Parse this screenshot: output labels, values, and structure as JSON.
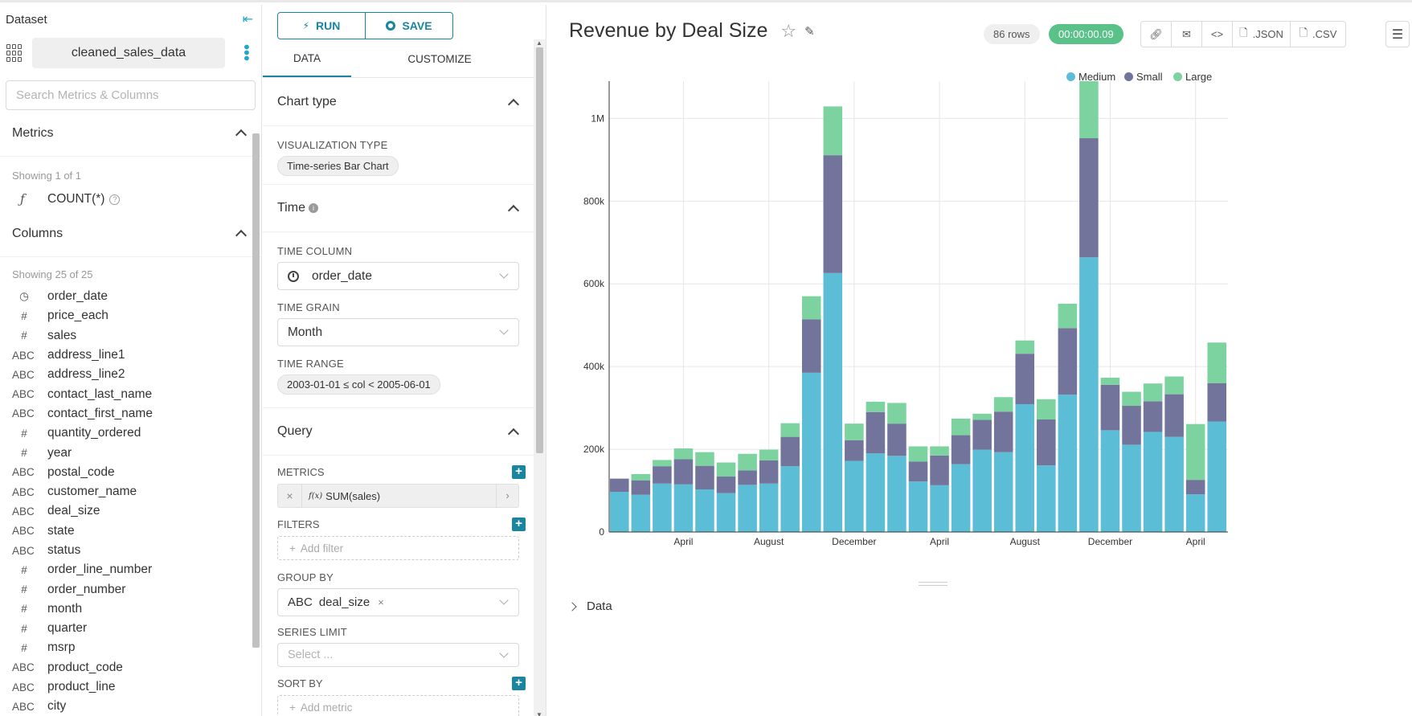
{
  "dataset_panel": {
    "title": "Dataset",
    "dataset_name": "cleaned_sales_data",
    "search_placeholder": "Search Metrics & Columns",
    "metrics_header": "Metrics",
    "metrics_showing": "Showing 1 of 1",
    "metrics": [
      {
        "type": "ƒ",
        "name": "COUNT(*)"
      }
    ],
    "columns_header": "Columns",
    "columns_showing": "Showing 25 of 25",
    "columns": [
      {
        "type": "clock",
        "name": "order_date"
      },
      {
        "type": "#",
        "name": "price_each"
      },
      {
        "type": "#",
        "name": "sales"
      },
      {
        "type": "ABC",
        "name": "address_line1"
      },
      {
        "type": "ABC",
        "name": "address_line2"
      },
      {
        "type": "ABC",
        "name": "contact_last_name"
      },
      {
        "type": "ABC",
        "name": "contact_first_name"
      },
      {
        "type": "#",
        "name": "quantity_ordered"
      },
      {
        "type": "#",
        "name": "year"
      },
      {
        "type": "ABC",
        "name": "postal_code"
      },
      {
        "type": "ABC",
        "name": "customer_name"
      },
      {
        "type": "ABC",
        "name": "deal_size"
      },
      {
        "type": "ABC",
        "name": "state"
      },
      {
        "type": "ABC",
        "name": "status"
      },
      {
        "type": "#",
        "name": "order_line_number"
      },
      {
        "type": "#",
        "name": "order_number"
      },
      {
        "type": "#",
        "name": "month"
      },
      {
        "type": "#",
        "name": "quarter"
      },
      {
        "type": "#",
        "name": "msrp"
      },
      {
        "type": "ABC",
        "name": "product_code"
      },
      {
        "type": "ABC",
        "name": "product_line"
      },
      {
        "type": "ABC",
        "name": "city"
      }
    ]
  },
  "control_panel": {
    "run_label": "RUN",
    "save_label": "SAVE",
    "tab_data": "DATA",
    "tab_customize": "CUSTOMIZE",
    "chart_type_header": "Chart type",
    "viz_type_label": "VISUALIZATION TYPE",
    "viz_type_value": "Time-series Bar Chart",
    "time_header": "Time",
    "time_column_label": "TIME COLUMN",
    "time_column_value": "order_date",
    "time_grain_label": "TIME GRAIN",
    "time_grain_value": "Month",
    "time_range_label": "TIME RANGE",
    "time_range_value": "2003-01-01 ≤ col < 2005-06-01",
    "query_header": "Query",
    "metrics_label": "METRICS",
    "metric_value": "SUM(sales)",
    "filters_label": "FILTERS",
    "add_filter": "Add filter",
    "group_by_label": "GROUP BY",
    "group_by_type": "ABC",
    "group_by_value": "deal_size",
    "series_limit_label": "SERIES LIMIT",
    "series_limit_placeholder": "Select ...",
    "sort_by_label": "SORT BY",
    "add_metric": "Add metric"
  },
  "chart_header": {
    "title": "Revenue by Deal Size",
    "rows": "86 rows",
    "elapsed": "00:00:00.09",
    "json_label": ".JSON",
    "csv_label": ".CSV"
  },
  "data_section_label": "Data",
  "colors": {
    "medium": "#5bbdd6",
    "small": "#72749b",
    "large": "#7dd3a0",
    "accent": "#1a85a0",
    "success": "#5ac189"
  },
  "chart_data": {
    "type": "bar",
    "stacked": true,
    "x": [
      "2003-01",
      "2003-02",
      "2003-03",
      "2003-04",
      "2003-05",
      "2003-06",
      "2003-07",
      "2003-08",
      "2003-09",
      "2003-10",
      "2003-11",
      "2003-12",
      "2004-01",
      "2004-02",
      "2004-03",
      "2004-04",
      "2004-05",
      "2004-06",
      "2004-07",
      "2004-08",
      "2004-09",
      "2004-10",
      "2004-11",
      "2004-12",
      "2005-01",
      "2005-02",
      "2005-03",
      "2005-04",
      "2005-05"
    ],
    "x_ticks": [
      {
        "x": "2003-04",
        "label": "April"
      },
      {
        "x": "2003-08",
        "label": "August"
      },
      {
        "x": "2003-12",
        "label": "December"
      },
      {
        "x": "2004-04",
        "label": "April"
      },
      {
        "x": "2004-08",
        "label": "August"
      },
      {
        "x": "2004-12",
        "label": "December"
      },
      {
        "x": "2005-04",
        "label": "April"
      }
    ],
    "y_ticks": [
      "0",
      "200k",
      "400k",
      "600k",
      "800k",
      "1M"
    ],
    "ylim": [
      0,
      1090000
    ],
    "grid": true,
    "legend_position": "top-right",
    "series": [
      {
        "name": "Medium",
        "color": "#5bbdd6",
        "values": [
          97000,
          90000,
          117000,
          115000,
          103000,
          94000,
          114000,
          117000,
          159000,
          385000,
          626000,
          172000,
          190000,
          184000,
          122000,
          113000,
          164000,
          199000,
          193000,
          309000,
          161000,
          332000,
          664000,
          246000,
          211000,
          242000,
          230000,
          91000,
          267000
        ]
      },
      {
        "name": "Small",
        "color": "#72749b",
        "values": [
          32000,
          35000,
          42000,
          61000,
          57000,
          40000,
          35000,
          56000,
          71000,
          129000,
          285000,
          50000,
          100000,
          78000,
          48000,
          72000,
          70000,
          72000,
          98000,
          122000,
          111000,
          161000,
          288000,
          110000,
          94000,
          74000,
          103000,
          35000,
          93000
        ]
      },
      {
        "name": "Large",
        "color": "#7dd3a0",
        "values": [
          0,
          15000,
          15000,
          26000,
          33000,
          34000,
          40000,
          26000,
          33000,
          56000,
          118000,
          40000,
          25000,
          50000,
          37000,
          22000,
          40000,
          15000,
          35000,
          32000,
          49000,
          59000,
          138000,
          17000,
          34000,
          43000,
          43000,
          135000,
          98000
        ]
      }
    ]
  }
}
